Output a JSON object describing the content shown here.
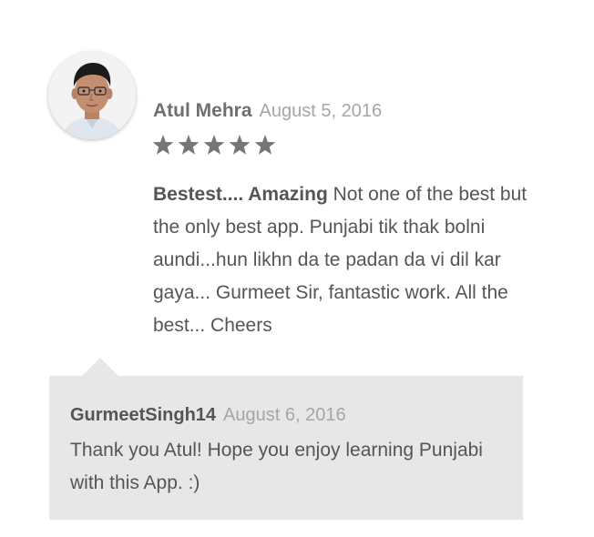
{
  "review": {
    "author": "Atul Mehra",
    "date": "August 5, 2016",
    "rating": 5,
    "rating_max": 5,
    "star_color": "#767676",
    "title": "Bestest.... Amazing",
    "text": "Not one of the best but the only best app. Punjabi tik thak bolni aundi...hun likhn da te padan da vi dil kar gaya... Gurmeet Sir, fantastic work. All the best... Cheers"
  },
  "reply": {
    "author": "GurmeetSingh14",
    "date": "August 6, 2016",
    "text": "Thank you Atul! Hope you enjoy learning Punjabi with this App. :)",
    "background_color": "#e7e7e7"
  }
}
